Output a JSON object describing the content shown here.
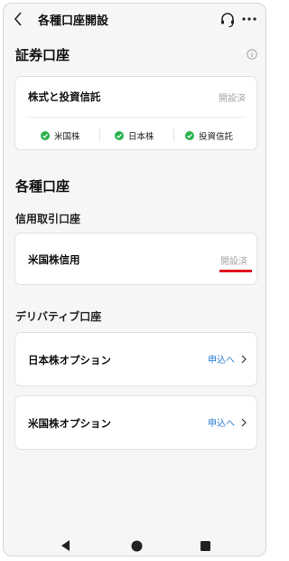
{
  "header": {
    "title": "各種口座開設"
  },
  "securities": {
    "section_title": "証券口座",
    "card_title": "株式と投資信託",
    "status": "開設済",
    "checks": [
      {
        "label": "米国株"
      },
      {
        "label": "日本株"
      },
      {
        "label": "投資信託"
      }
    ]
  },
  "accounts": {
    "section_title": "各種口座",
    "margin": {
      "subtitle": "信用取引口座",
      "card_title": "米国株信用",
      "status": "開設済"
    },
    "derivatives": {
      "subtitle": "デリバティブ口座",
      "items": [
        {
          "title": "日本株オプション",
          "action": "申込へ"
        },
        {
          "title": "米国株オプション",
          "action": "申込へ"
        }
      ]
    }
  },
  "colors": {
    "accent": "#2a7fd4",
    "check": "#2bb24c",
    "highlight": "#e0141e"
  },
  "icons": [
    "back-arrow-icon",
    "headset-icon",
    "more-icon",
    "info-icon",
    "check-icon",
    "chevron-right-icon",
    "nav-back-icon",
    "nav-home-icon",
    "nav-recents-icon"
  ]
}
